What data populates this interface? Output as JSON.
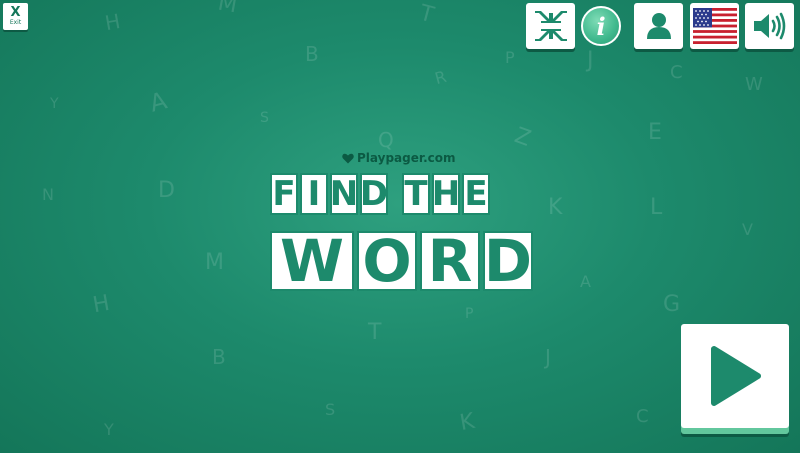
{
  "exit": {
    "label": "X",
    "sublabel": "Exit"
  },
  "brand": {
    "text": "Playpager.com",
    "heart_icon": "heart-icon"
  },
  "title": {
    "line1": [
      "F",
      "I",
      "N",
      "D",
      " ",
      "T",
      "H",
      "E"
    ],
    "line2": [
      "W",
      "O",
      "R",
      "D"
    ]
  },
  "toolbar": {
    "fullscreen_icon": "compress-icon",
    "info_label": "i",
    "profile_icon": "user-icon",
    "language_icon": "us-flag-icon",
    "sound_icon": "speaker-icon"
  },
  "play": {
    "icon": "play-icon"
  },
  "colors": {
    "accent": "#1d8a6c",
    "dark": "#0b5a43",
    "button": "#ffffff",
    "background": "#1d8a6c"
  },
  "background_letters": [
    "M",
    "T",
    "H",
    "B",
    "P",
    "J",
    "R",
    "C",
    "W",
    "Y",
    "A",
    "S",
    "Q",
    "Z",
    "E",
    "D",
    "N",
    "K",
    "L",
    "V",
    "M",
    "A",
    "G",
    "H",
    "T",
    "P",
    "B",
    "J",
    "S",
    "C",
    "Y",
    "K"
  ]
}
